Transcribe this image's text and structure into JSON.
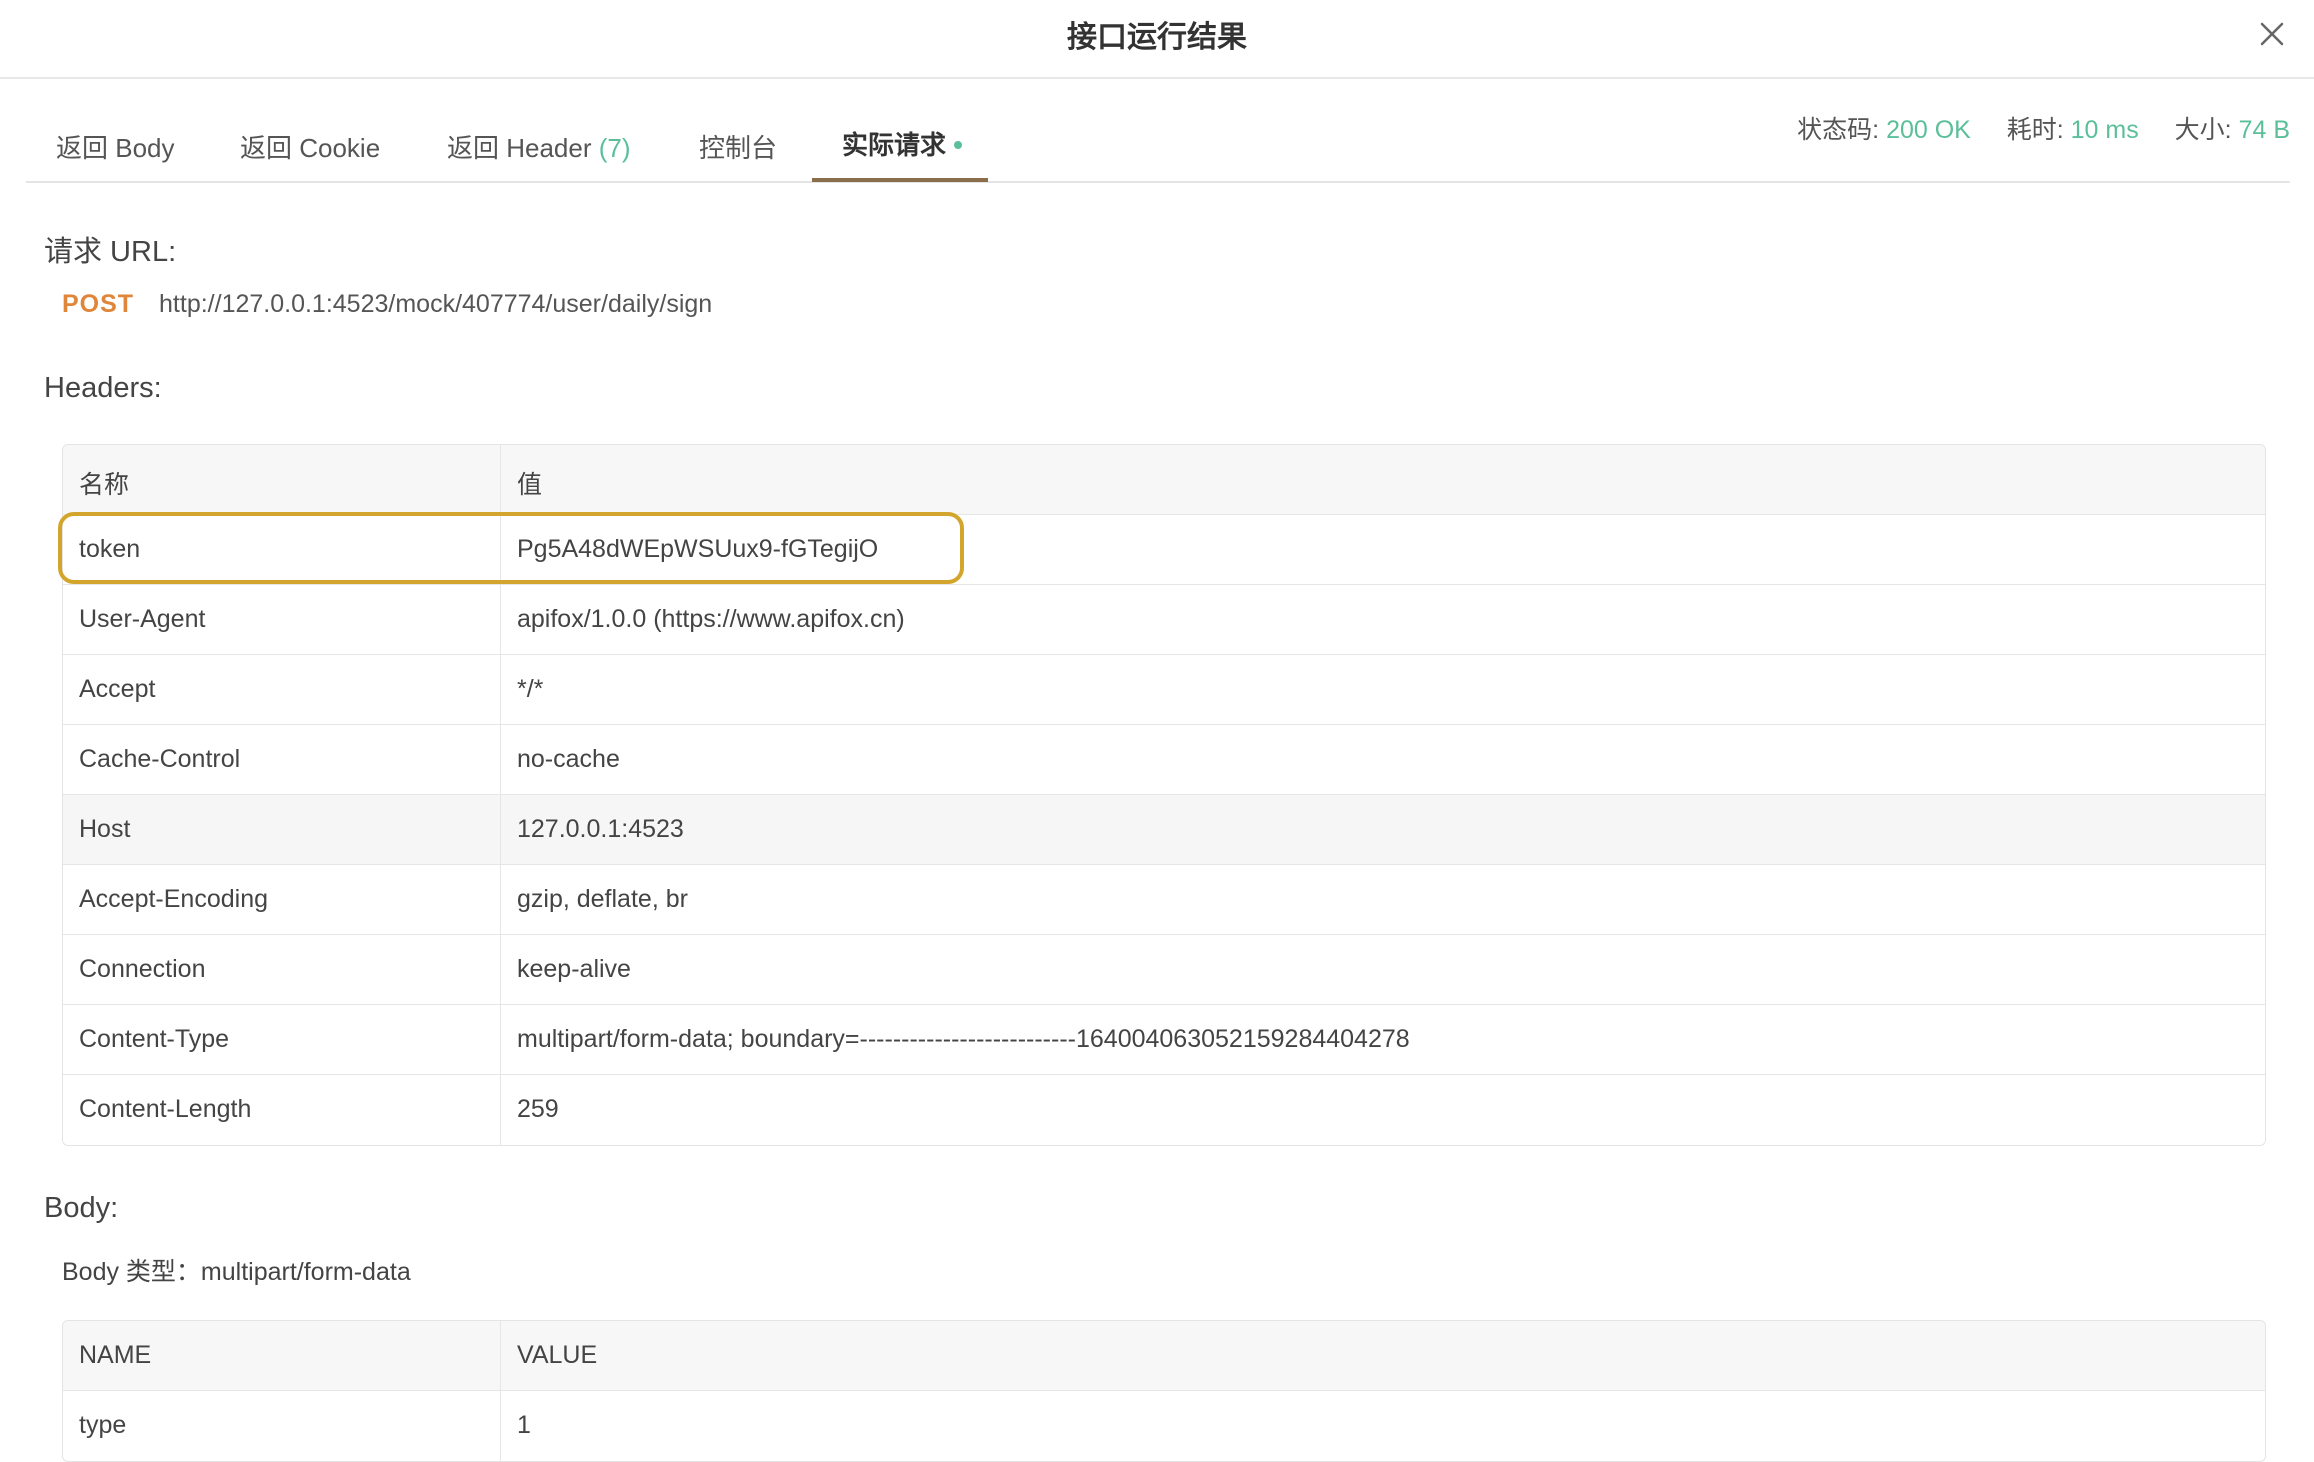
{
  "dialog": {
    "title": "接口运行结果",
    "close_icon": "close-icon"
  },
  "tabs": [
    {
      "label": "返回 Body",
      "count": ""
    },
    {
      "label": "返回 Cookie",
      "count": ""
    },
    {
      "label": "返回 Header",
      "count": "(7)"
    },
    {
      "label": "控制台",
      "count": ""
    },
    {
      "label": "实际请求",
      "count": "",
      "active": true
    }
  ],
  "status": {
    "code_label": "状态码:",
    "code_value": "200 OK",
    "time_label": "耗时:",
    "time_value": "10 ms",
    "size_label": "大小:",
    "size_value": "74 B"
  },
  "request": {
    "url_heading": "请求 URL:",
    "method": "POST",
    "url": "http://127.0.0.1:4523/mock/407774/user/daily/sign"
  },
  "headers": {
    "heading": "Headers:",
    "col_name": "名称",
    "col_value": "值",
    "rows": [
      {
        "name": "token",
        "value": "Pg5A48dWEpWSUux9-fGTegijO"
      },
      {
        "name": "User-Agent",
        "value": "apifox/1.0.0 (https://www.apifox.cn)"
      },
      {
        "name": "Accept",
        "value": "*/*"
      },
      {
        "name": "Cache-Control",
        "value": "no-cache"
      },
      {
        "name": "Host",
        "value": "127.0.0.1:4523"
      },
      {
        "name": "Accept-Encoding",
        "value": "gzip, deflate, br"
      },
      {
        "name": "Connection",
        "value": "keep-alive"
      },
      {
        "name": "Content-Type",
        "value": "multipart/form-data; boundary=--------------------------164004063052159284404278"
      },
      {
        "name": "Content-Length",
        "value": "259"
      }
    ]
  },
  "body": {
    "heading": "Body:",
    "type_label": "Body 类型：multipart/form-data",
    "col_name": "NAME",
    "col_value": "VALUE",
    "rows": [
      {
        "name": "type",
        "value": "1"
      }
    ]
  },
  "colors": {
    "accent_green": "#5bbf9a",
    "method_orange": "#e0863a",
    "highlight_gold": "#d4a52c",
    "tab_underline": "#8a6e4b"
  }
}
